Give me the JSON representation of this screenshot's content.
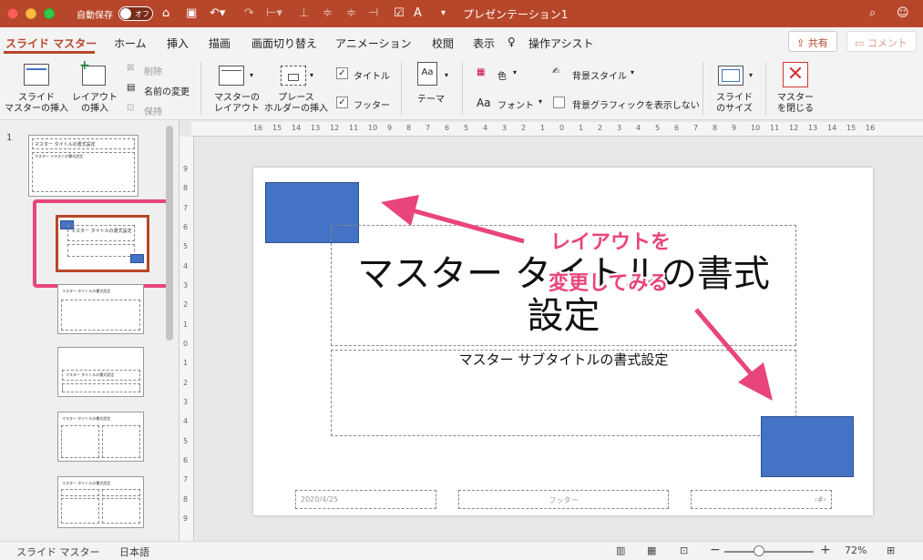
{
  "titlebar": {
    "autosave_label": "自動保存",
    "autosave_state": "オフ",
    "document_title": "プレゼンテーション1"
  },
  "tabs": [
    "スライド マスター",
    "ホーム",
    "挿入",
    "描画",
    "画面切り替え",
    "アニメーション",
    "校閲",
    "表示",
    "操作アシスト"
  ],
  "header_buttons": {
    "share": "共有",
    "comment": "コメント"
  },
  "ribbon": {
    "insert_master": [
      "スライド",
      "マスターの挿入"
    ],
    "insert_layout": [
      "レイアウト",
      "の挿入"
    ],
    "delete": "削除",
    "rename": "名前の変更",
    "preserve": "保持",
    "master_layout": [
      "マスターの",
      "レイアウト"
    ],
    "insert_placeholder": [
      "プレース",
      "ホルダーの挿入"
    ],
    "title_checkbox": "タイトル",
    "footer_checkbox": "フッター",
    "theme": "テーマ",
    "colors": "色",
    "fonts": "フォント",
    "background_styles": "背景スタイル",
    "hide_background": "背景グラフィックを表示しない",
    "slide_size": [
      "スライド",
      "のサイズ"
    ],
    "close_master": [
      "マスター",
      "を閉じる"
    ]
  },
  "thumbnails": {
    "slide_number": "1",
    "master_title": "マスター タイトルの書式設定",
    "layout_title": "マスター タイトルの書式設定",
    "subtitle_short": "マスター テキストの書式設定"
  },
  "ruler": {
    "horizontal": [
      "16",
      "15",
      "14",
      "13",
      "12",
      "11",
      "10",
      "9",
      "8",
      "7",
      "6",
      "5",
      "4",
      "3",
      "2",
      "1",
      "0",
      "1",
      "2",
      "3",
      "4",
      "5",
      "6",
      "7",
      "8",
      "9",
      "10",
      "11",
      "12",
      "13",
      "14",
      "15",
      "16"
    ],
    "vertical": [
      "9",
      "8",
      "7",
      "6",
      "5",
      "4",
      "3",
      "2",
      "1",
      "0",
      "1",
      "2",
      "3",
      "4",
      "5",
      "6",
      "7",
      "8",
      "9"
    ]
  },
  "slide": {
    "title_line1": "マスター タイトルの書式",
    "title_line2": "設定",
    "subtitle": "マスター サブタイトルの書式設定",
    "date": "2020/4/25",
    "footer": "フッター",
    "page_number": "‹#›"
  },
  "annotation": {
    "line1": "レイアウトを",
    "line2": "変更してみる",
    "color": "#e8457a"
  },
  "statusbar": {
    "view": "スライド マスター",
    "language": "日本語",
    "zoom": "72%"
  },
  "colors": {
    "accent": "#b7472a",
    "shape_fill": "#4472c4",
    "highlight": "#e8457a"
  }
}
